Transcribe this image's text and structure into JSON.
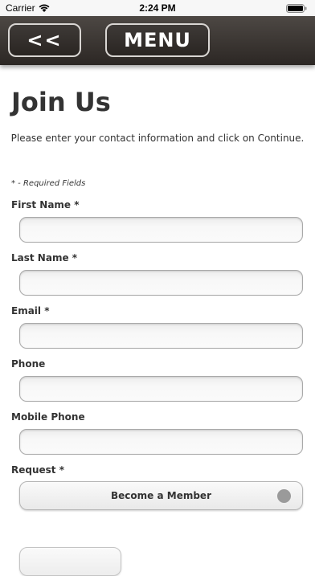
{
  "status_bar": {
    "carrier": "Carrier",
    "time": "2:24 PM"
  },
  "nav": {
    "back_label": "<<",
    "menu_label": "MENU"
  },
  "page": {
    "title": "Join Us",
    "intro": "Please enter your contact information and click on Continue.",
    "required_note": "* - Required Fields"
  },
  "form": {
    "fields": [
      {
        "label": "First Name *",
        "value": ""
      },
      {
        "label": "Last Name *",
        "value": ""
      },
      {
        "label": "Email *",
        "value": ""
      },
      {
        "label": "Phone",
        "value": ""
      },
      {
        "label": "Mobile Phone",
        "value": ""
      }
    ],
    "request": {
      "label": "Request *",
      "selected": "Become a Member"
    }
  },
  "colors": {
    "nav_bg": "#3a3532",
    "text": "#333333",
    "radio_dot": "#9a9a9a"
  }
}
